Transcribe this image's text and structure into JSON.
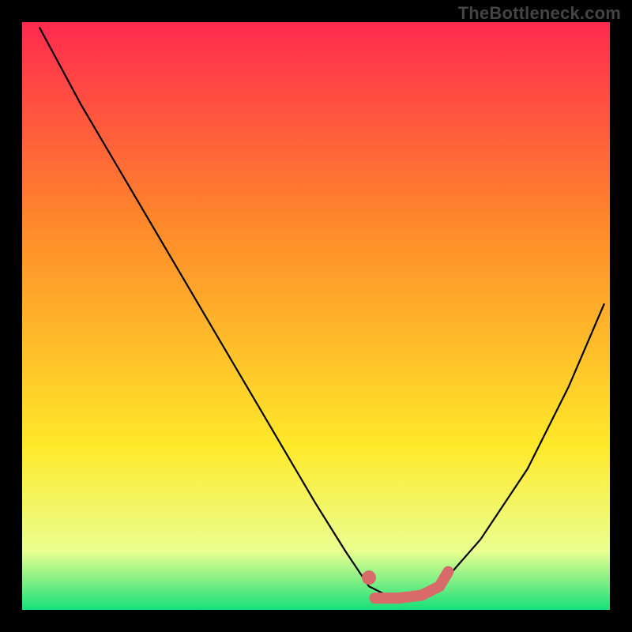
{
  "watermark": "TheBottleneck.com",
  "chart_data": {
    "type": "line",
    "title": "",
    "xlabel": "",
    "ylabel": "",
    "xlim": [
      0,
      100
    ],
    "ylim": [
      0,
      100
    ],
    "grid": false,
    "legend": false,
    "background_gradient": {
      "top": "#ff2a4f",
      "mid_upper": "#ff8a2a",
      "mid_lower": "#ffe92a",
      "band": "#eaff90",
      "bottom": "#18e07a"
    },
    "series": [
      {
        "name": "bottleneck-curve",
        "color": "#000000",
        "x": [
          3,
          10,
          20,
          30,
          40,
          50,
          55,
          59,
          63,
          67,
          71,
          78,
          86,
          93,
          99
        ],
        "y": [
          99,
          86,
          69,
          52,
          35,
          18,
          10,
          4,
          2,
          2,
          4,
          12,
          24,
          38,
          52
        ]
      },
      {
        "name": "optimal-marker-dot",
        "type": "scatter",
        "color": "#d96a6a",
        "x": [
          59
        ],
        "y": [
          5.5
        ]
      },
      {
        "name": "optimal-marker-segment",
        "type": "line",
        "color": "#d96a6a",
        "thick": true,
        "x": [
          60,
          64,
          68,
          71,
          72.5
        ],
        "y": [
          2,
          2,
          2.5,
          4,
          6.5
        ]
      }
    ]
  }
}
